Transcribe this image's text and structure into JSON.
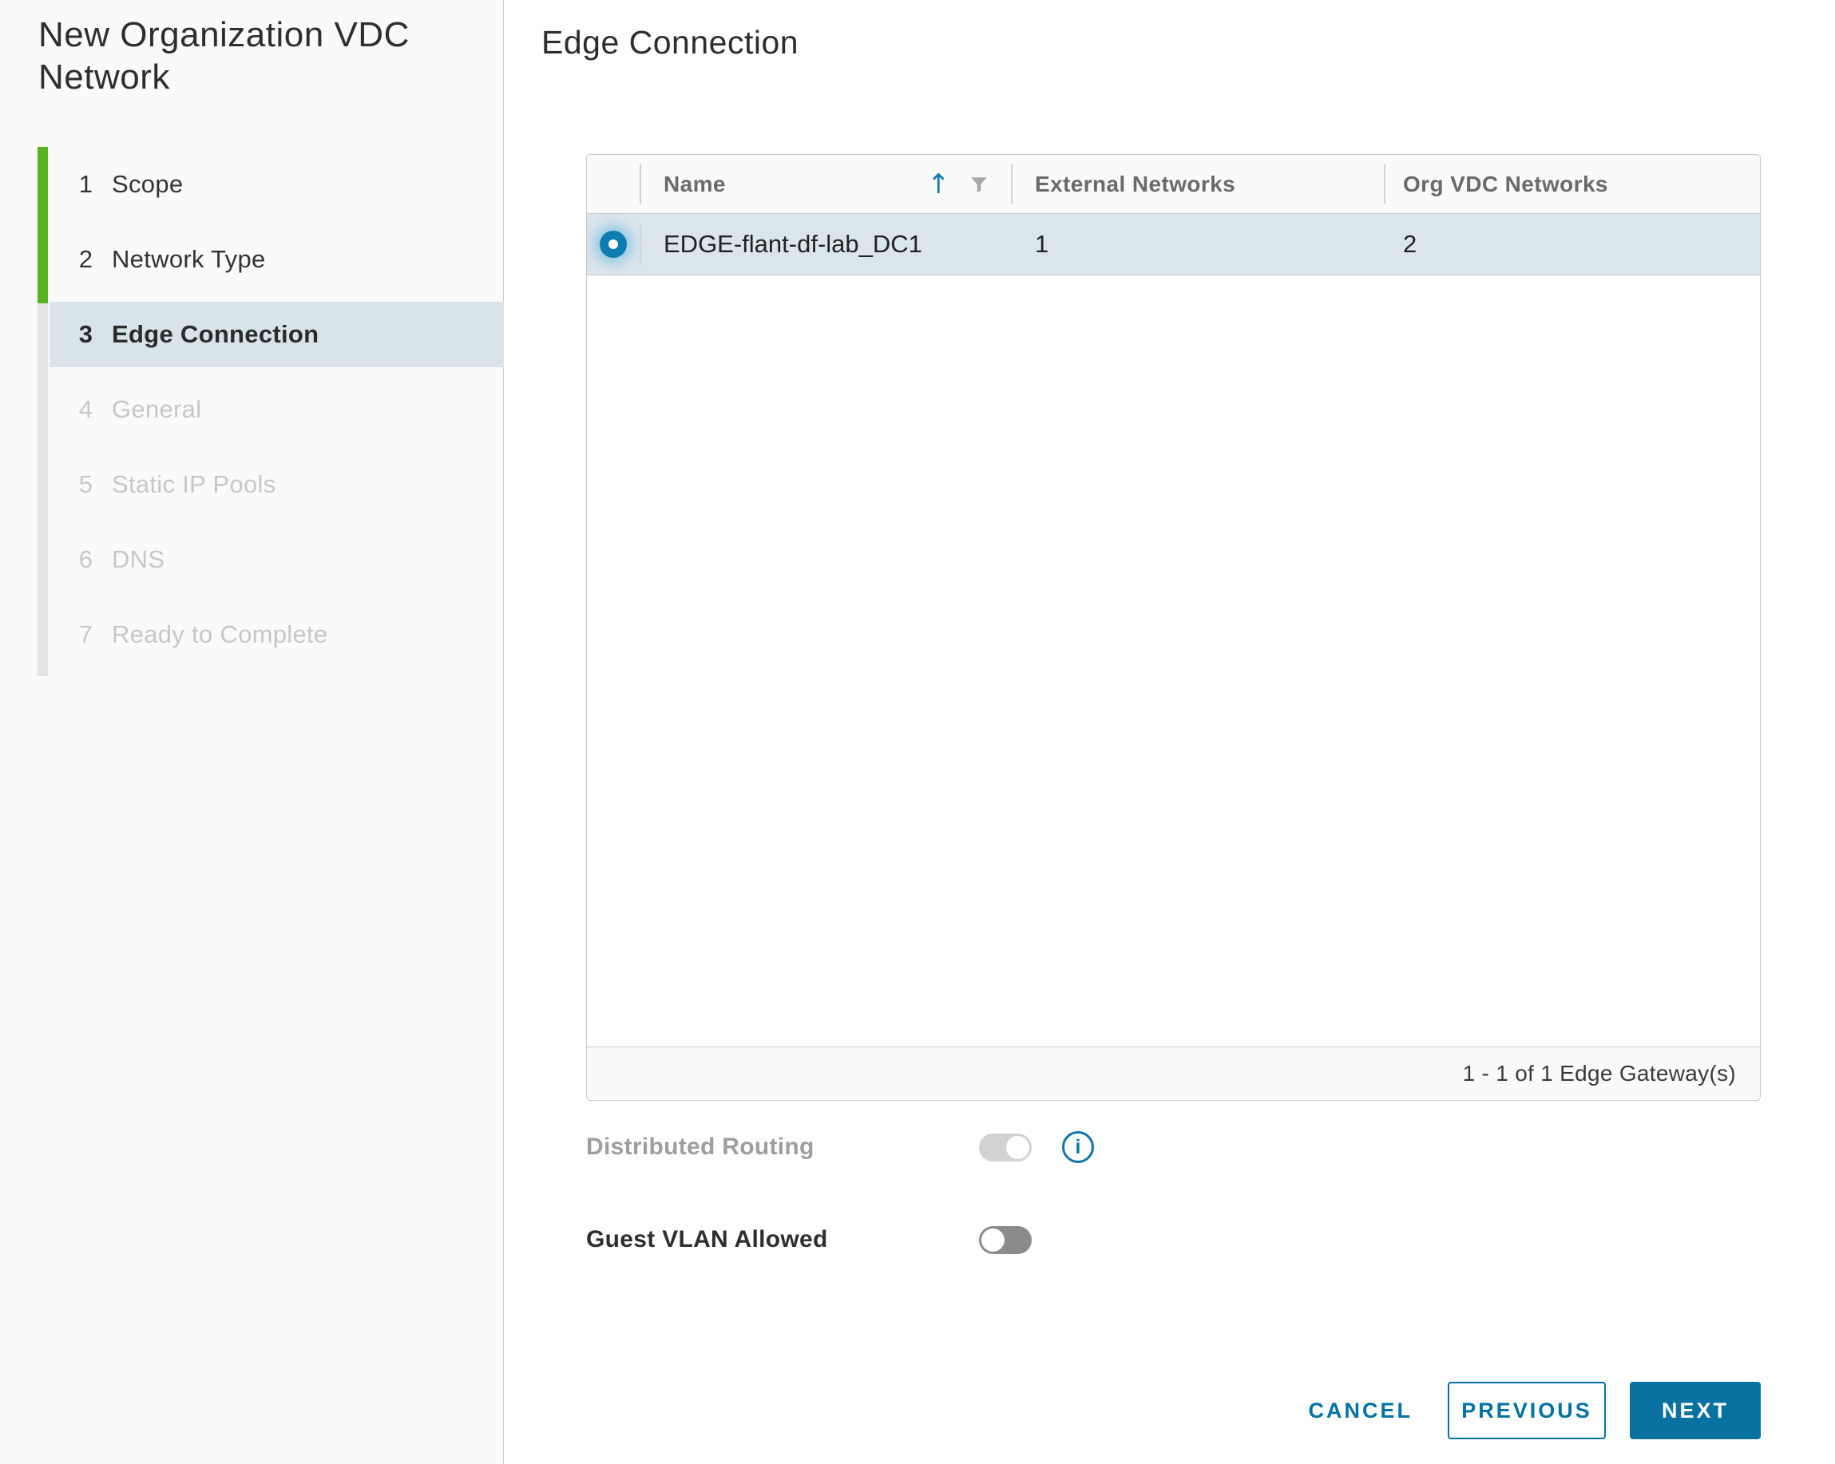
{
  "colors": {
    "accent_blue": "#0072a3",
    "progress_green": "#55b221",
    "selected_row_bg": "#dbe5ec",
    "active_step_bg": "#d8e3ea",
    "sidebar_bg": "#fafafa",
    "disabled_text": "#c7c7c7"
  },
  "sidebar": {
    "title": "New Organization VDC Network",
    "steps": [
      {
        "num": "1",
        "label": "Scope",
        "state": "completed"
      },
      {
        "num": "2",
        "label": "Network Type",
        "state": "completed"
      },
      {
        "num": "3",
        "label": "Edge Connection",
        "state": "current"
      },
      {
        "num": "4",
        "label": "General",
        "state": "upcoming"
      },
      {
        "num": "5",
        "label": "Static IP Pools",
        "state": "upcoming"
      },
      {
        "num": "6",
        "label": "DNS",
        "state": "upcoming"
      },
      {
        "num": "7",
        "label": "Ready to Complete",
        "state": "upcoming"
      }
    ]
  },
  "main": {
    "title": "Edge Connection",
    "table": {
      "columns": [
        {
          "label": "Name",
          "sorted": "ascending",
          "icons": [
            "sort-ascending-icon",
            "filter-icon"
          ]
        },
        {
          "label": "External Networks"
        },
        {
          "label": "Org VDC Networks"
        }
      ],
      "rows": [
        {
          "selected": true,
          "name": "EDGE-flant-df-lab_DC1",
          "external_networks": "1",
          "org_vdc_networks": "2"
        }
      ],
      "footer": "1 - 1 of 1 Edge Gateway(s)"
    },
    "toggles": {
      "distributed_routing": {
        "label": "Distributed Routing",
        "state": "on",
        "disabled": true,
        "has_info_icon": true,
        "info_glyph": "i"
      },
      "guest_vlan": {
        "label": "Guest VLAN Allowed",
        "state": "off",
        "disabled": false
      }
    },
    "actions": {
      "cancel": "CANCEL",
      "previous": "PREVIOUS",
      "next": "NEXT"
    }
  }
}
